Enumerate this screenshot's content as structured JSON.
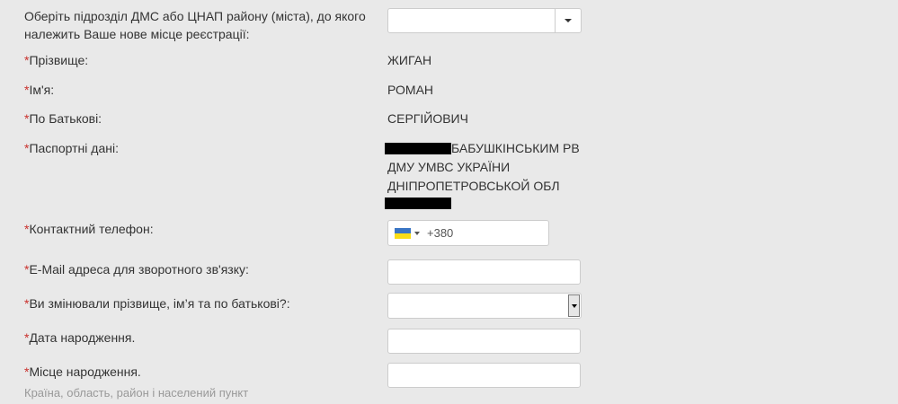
{
  "form": {
    "dms_office": {
      "label": "Оберіть підрозділ ДМС або ЦНАП району (міста), до якого належить Ваше нове місце реєстрації:",
      "value": ""
    },
    "surname": {
      "required_mark": "*",
      "label": "Прізвище:",
      "value": "ЖИГАН"
    },
    "first_name": {
      "required_mark": "*",
      "label": "Ім'я:",
      "value": "РОМАН"
    },
    "patronymic": {
      "required_mark": "*",
      "label": "По Батькові:",
      "value": "СЕРГІЙОВИЧ"
    },
    "passport": {
      "required_mark": "*",
      "label": "Паспортні дані:",
      "issuer_line1": "БАБУШКІНСЬКИМ РВ",
      "issuer_line2": "ДМУ УМВС УКРАЇНИ",
      "issuer_line3": "ДНІПРОПЕТРОВСЬКОЙ ОБЛ"
    },
    "phone": {
      "required_mark": "*",
      "label": "Контактний телефон:",
      "country_code": "+380",
      "flag_colors": [
        "#3a75c4",
        "#f9dd16"
      ]
    },
    "email": {
      "required_mark": "*",
      "label": "E-Mail адреса для зворотного зв'язку:",
      "value": ""
    },
    "name_changed": {
      "required_mark": "*",
      "label": "Ви змінювали прізвище, ім’я та по батькові?:",
      "value": ""
    },
    "birth_date": {
      "required_mark": "*",
      "label": "Дата народження.",
      "value": ""
    },
    "birth_place": {
      "required_mark": "*",
      "label": "Місце народження.",
      "hint": "Країна, область, район і населений пункт",
      "value": ""
    }
  }
}
